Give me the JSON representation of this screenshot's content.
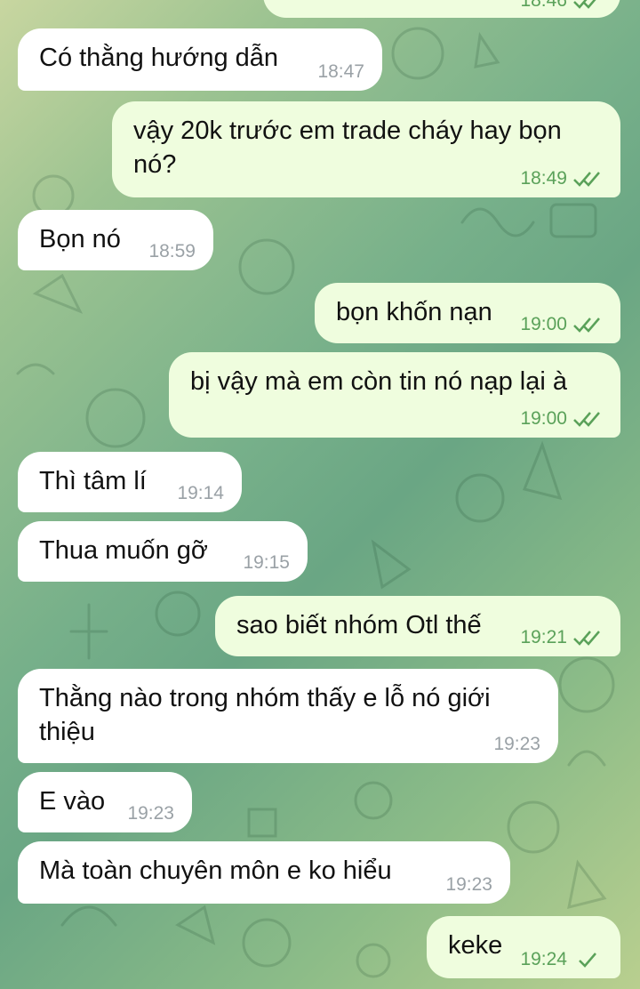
{
  "colors": {
    "incoming_bubble": "#ffffff",
    "outgoing_bubble": "#effdde",
    "outgoing_meta": "#5aa159",
    "incoming_meta": "#9aa1a6"
  },
  "messages": [
    {
      "id": "m0",
      "direction": "outgoing",
      "text": "",
      "time": "18:46",
      "status": "read"
    },
    {
      "id": "m1",
      "direction": "incoming",
      "text": "Có thằng hướng dẫn",
      "time": "18:47"
    },
    {
      "id": "m2",
      "direction": "outgoing",
      "text": "vậy 20k trước em trade cháy hay bọn nó?",
      "time": "18:49",
      "status": "read"
    },
    {
      "id": "m3",
      "direction": "incoming",
      "text": "Bọn nó",
      "time": "18:59"
    },
    {
      "id": "m4",
      "direction": "outgoing",
      "text": "bọn khốn nạn",
      "time": "19:00",
      "status": "read"
    },
    {
      "id": "m5",
      "direction": "outgoing",
      "text": "bị vậy mà em còn tin nó nạp lại à",
      "time": "19:00",
      "status": "read"
    },
    {
      "id": "m6",
      "direction": "incoming",
      "text": "Thì tâm lí",
      "time": "19:14"
    },
    {
      "id": "m7",
      "direction": "incoming",
      "text": "Thua muốn gỡ",
      "time": "19:15"
    },
    {
      "id": "m8",
      "direction": "outgoing",
      "text": "sao biết nhóm Otl thế",
      "time": "19:21",
      "status": "read"
    },
    {
      "id": "m9",
      "direction": "incoming",
      "text": "Thằng nào trong nhóm thấy e lỗ nó giới thiệu",
      "time": "19:23"
    },
    {
      "id": "m10",
      "direction": "incoming",
      "text": "E vào",
      "time": "19:23"
    },
    {
      "id": "m11",
      "direction": "incoming",
      "text": "Mà toàn chuyên môn e ko hiểu",
      "time": "19:23"
    },
    {
      "id": "m12",
      "direction": "outgoing",
      "text": "keke",
      "time": "19:24",
      "status": "sent"
    }
  ]
}
